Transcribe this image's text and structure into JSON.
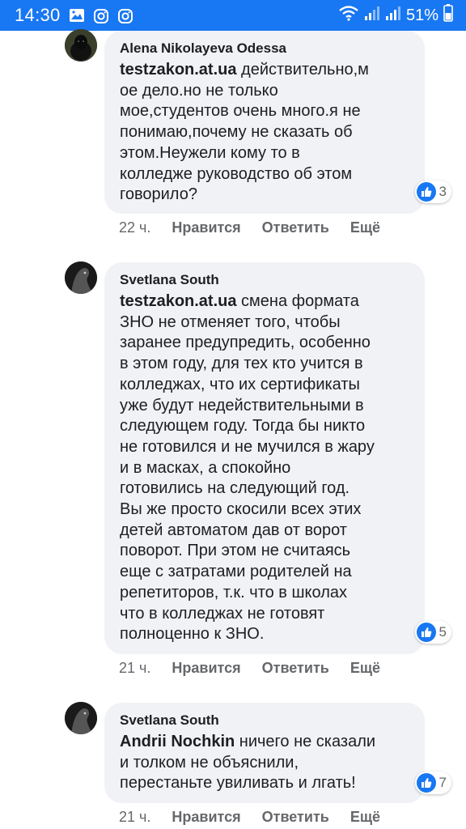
{
  "statusbar": {
    "time": "14:30",
    "battery": "51%",
    "icons": [
      "gallery-icon",
      "instagram-icon",
      "instagram-icon",
      "wifi-icon",
      "signal-icon",
      "signal-icon"
    ]
  },
  "comments": [
    {
      "author": "Alena Nikolayeva Odessa",
      "mention": "testzakon.at.ua",
      "text": " действительно,м\nое дело.но не только\nмое,студентов очень много.я не\nпонимаю,почему не сказать об\nэтом.Неужели кому то в\nколледже руководство об этом\nговорило?",
      "likes": "3",
      "time": "22 ч.",
      "like_label": "Нравится",
      "reply_label": "Ответить",
      "more_label": "Ещё"
    },
    {
      "author": "Svetlana South",
      "mention": "testzakon.at.ua",
      "text": " смена формата\nЗНО не отменяет того, чтобы\nзаранее предупредить, особенно\nв этом году, для тех кто учится в\nколледжах, что их сертификаты\nуже будут недействительными в\nследующем году. Тогда бы никто\nне готовился и не мучился в жару\nи в масках, а спокойно\nготовились на следующий год.\nВы же просто скосили всех этих\nдетей автоматом дав от ворот\nповорот. При этом не считаясь\nеще с затратами родителей на\nрепетиторов, т.к. что в школах\nчто в колледжах не готовят\nполноценно к ЗНО.",
      "likes": "5",
      "time": "21 ч.",
      "like_label": "Нравится",
      "reply_label": "Ответить",
      "more_label": "Ещё"
    },
    {
      "author": "Svetlana South",
      "mention": "Andrii Nochkin",
      "text": " ничего не сказали\nи толком не объяснили,\nперестаньте увиливать и лгать!",
      "likes": "7",
      "time": "21 ч.",
      "like_label": "Нравится",
      "reply_label": "Ответить",
      "more_label": "Ещё"
    }
  ]
}
